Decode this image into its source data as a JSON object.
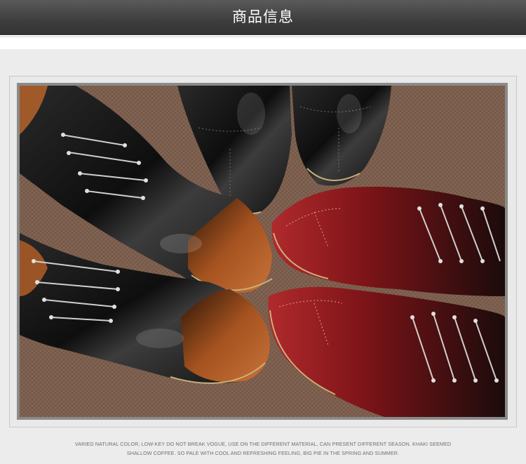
{
  "header": {
    "title": "商品信息"
  },
  "product_photo": {
    "subject": "shoe-photo"
  },
  "caption": {
    "line1": "VARIED NATURAL COLOR, LOW-KEY DO NOT BREAK VOGUE, USE ON THE DIFFERENT MATERIAL, CAN PRESENT DIFFERENT SEASON. KHAKI SEEMED",
    "line2": "SHALLOW COFFEE. SO PALE WITH COOL AND REFRESHING FEELING, BIG PIE IN THE SPRING AND SUMMER."
  },
  "colors": {
    "header_bg": "#3d3d3d",
    "panel_bg": "#ececec",
    "carpet": "#7b5e4e",
    "shoe_black": "#141414",
    "shoe_tan": "#b5602a",
    "shoe_red": "#8e1a1f"
  }
}
